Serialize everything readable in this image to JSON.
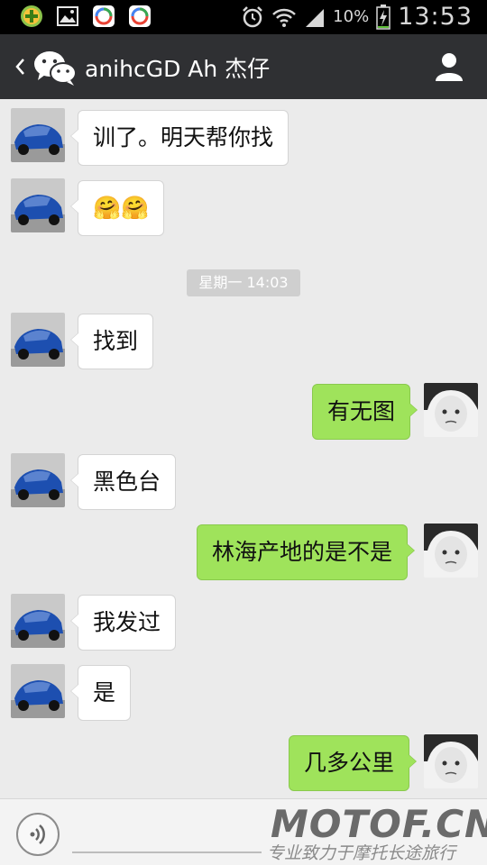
{
  "status_bar": {
    "battery_text": "10%",
    "time": "13:53",
    "icons": [
      "plus-circle-icon",
      "gallery-icon",
      "browser-app-icon",
      "browser-app-icon",
      "alarm-icon",
      "wifi-icon",
      "signal-icon",
      "battery-charging-icon"
    ]
  },
  "header": {
    "title": "anihcGD Ah 杰仔",
    "icons": [
      "back-chevron-icon",
      "wechat-logo-icon",
      "contact-profile-icon"
    ],
    "background": "#2f3033"
  },
  "chat": {
    "timestamp": "星期一 14:03",
    "messages": [
      {
        "side": "left",
        "text": "训了。明天帮你找"
      },
      {
        "side": "left",
        "text": "🤗🤗"
      },
      {
        "side": "left",
        "text": "找到"
      },
      {
        "side": "right",
        "text": "有无图"
      },
      {
        "side": "left",
        "text": "黑色台"
      },
      {
        "side": "right",
        "text": "林海产地的是不是"
      },
      {
        "side": "left",
        "text": "我发过"
      },
      {
        "side": "left",
        "text": "是"
      },
      {
        "side": "right",
        "text": "几多公里"
      }
    ],
    "colors": {
      "incoming_bubble": "#ffffff",
      "outgoing_bubble": "#9fe35b",
      "background": "#ebebeb"
    }
  },
  "input_bar": {
    "icons": [
      "voice-icon"
    ]
  },
  "watermark": {
    "main": "MOTOF.CN",
    "sub": "专业致力于摩托长途旅行"
  }
}
